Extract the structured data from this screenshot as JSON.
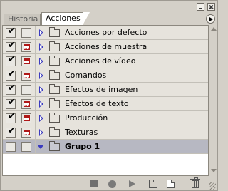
{
  "window": {
    "minimize_icon": "minimize-icon",
    "close_icon": "close-icon"
  },
  "tabs": [
    {
      "label": "Historia",
      "active": false
    },
    {
      "label": "Acciones",
      "active": true
    }
  ],
  "panel_menu_icon": "panel-menu-arrow-icon",
  "actions": [
    {
      "label": "Acciones por defecto",
      "checked": true,
      "dialog": false,
      "expanded": false,
      "selected": false
    },
    {
      "label": "Acciones de muestra",
      "checked": true,
      "dialog": true,
      "expanded": false,
      "selected": false
    },
    {
      "label": "Acciones de vídeo",
      "checked": true,
      "dialog": true,
      "expanded": false,
      "selected": false
    },
    {
      "label": "Comandos",
      "checked": true,
      "dialog": true,
      "expanded": false,
      "selected": false
    },
    {
      "label": "Efectos de imagen",
      "checked": true,
      "dialog": false,
      "expanded": false,
      "selected": false
    },
    {
      "label": "Efectos de texto",
      "checked": true,
      "dialog": true,
      "expanded": false,
      "selected": false
    },
    {
      "label": "Producción",
      "checked": true,
      "dialog": true,
      "expanded": false,
      "selected": false
    },
    {
      "label": "Texturas",
      "checked": true,
      "dialog": true,
      "expanded": false,
      "selected": false
    },
    {
      "label": "Grupo 1",
      "checked": false,
      "dialog": false,
      "expanded": true,
      "selected": true
    }
  ],
  "toolbar": [
    "stop-icon",
    "record-icon",
    "play-icon",
    "new-set-folder-icon",
    "new-action-icon",
    "trash-icon"
  ],
  "colors": {
    "dialog_red": "#b01818",
    "expander_blue": "#3b3bbf",
    "selected_row": "#b7b8c2"
  }
}
